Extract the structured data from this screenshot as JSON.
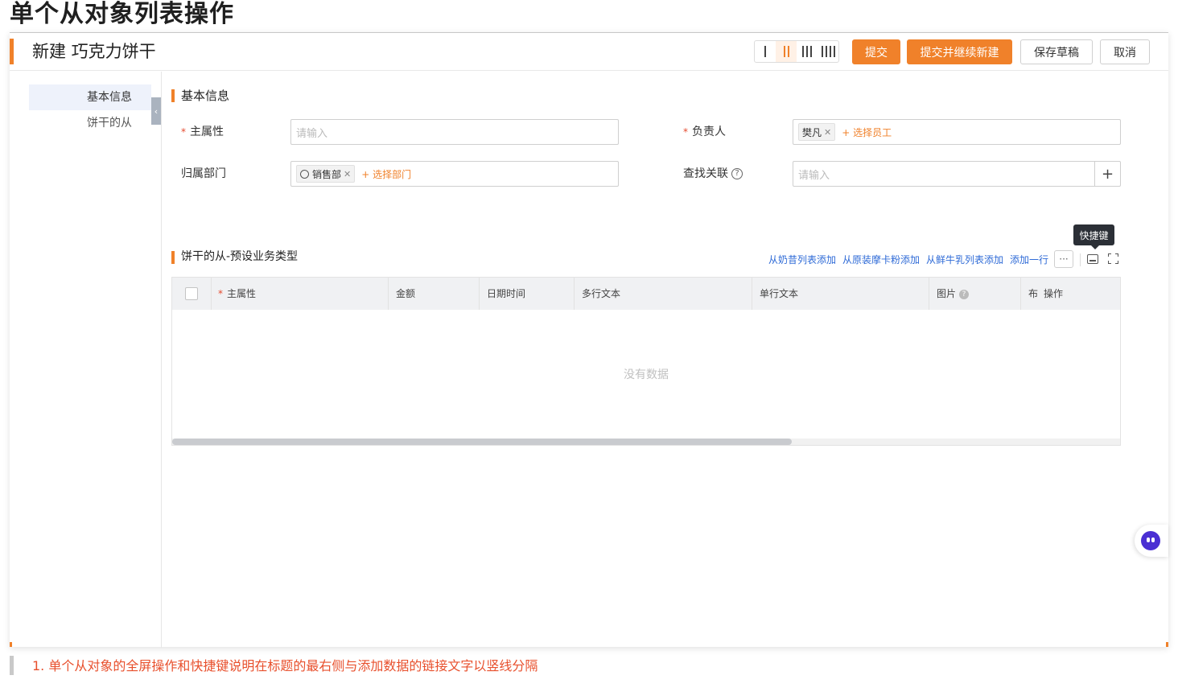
{
  "doc_title": "单个从对象列表操作",
  "header": {
    "title": "新建 巧克力饼干",
    "buttons": {
      "submit": "提交",
      "submit_continue": "提交并继续新建",
      "save_draft": "保存草稿",
      "cancel": "取消"
    },
    "column_toggle": {
      "options": [
        1,
        2,
        3,
        4
      ],
      "selected": 2
    }
  },
  "sidenav": {
    "items": [
      {
        "label": "基本信息",
        "active": true
      },
      {
        "label": "饼干的从",
        "active": false
      }
    ],
    "collapse_glyph": "‹"
  },
  "basic_section": {
    "title": "基本信息",
    "fields": {
      "main_attr": {
        "label": "主属性",
        "required_mark": "*",
        "placeholder": "请输入"
      },
      "owner": {
        "label": "负责人",
        "required_mark": "*",
        "tag": "樊凡",
        "add_label": "+ 选择员工"
      },
      "department": {
        "label": "归属部门",
        "tag": "销售部",
        "add_label": "+ 选择部门"
      },
      "lookup": {
        "label": "查找关联",
        "help": "?",
        "placeholder": "请输入",
        "add": "+"
      }
    }
  },
  "detail_section": {
    "title": "饼干的从-预设业务类型",
    "toolbar": {
      "links": [
        "从奶昔列表添加",
        "从原装摩卡粉添加",
        "从鲜牛乳列表添加",
        "添加一行"
      ],
      "more": "···",
      "tooltip": "快捷键"
    },
    "table": {
      "required_mark": "*",
      "columns": [
        "主属性",
        "金额",
        "日期时间",
        "多行文本",
        "单行文本",
        "图片",
        "布",
        "操作"
      ],
      "image_help": "?",
      "rows": [],
      "empty_text": "没有数据"
    }
  },
  "note": "1. 单个从对象的全屏操作和快捷键说明在标题的最右侧与添加数据的链接文字以竖线分隔",
  "colors": {
    "accent": "#f0812a",
    "link": "#2f6bd7",
    "note": "#e8502d"
  }
}
